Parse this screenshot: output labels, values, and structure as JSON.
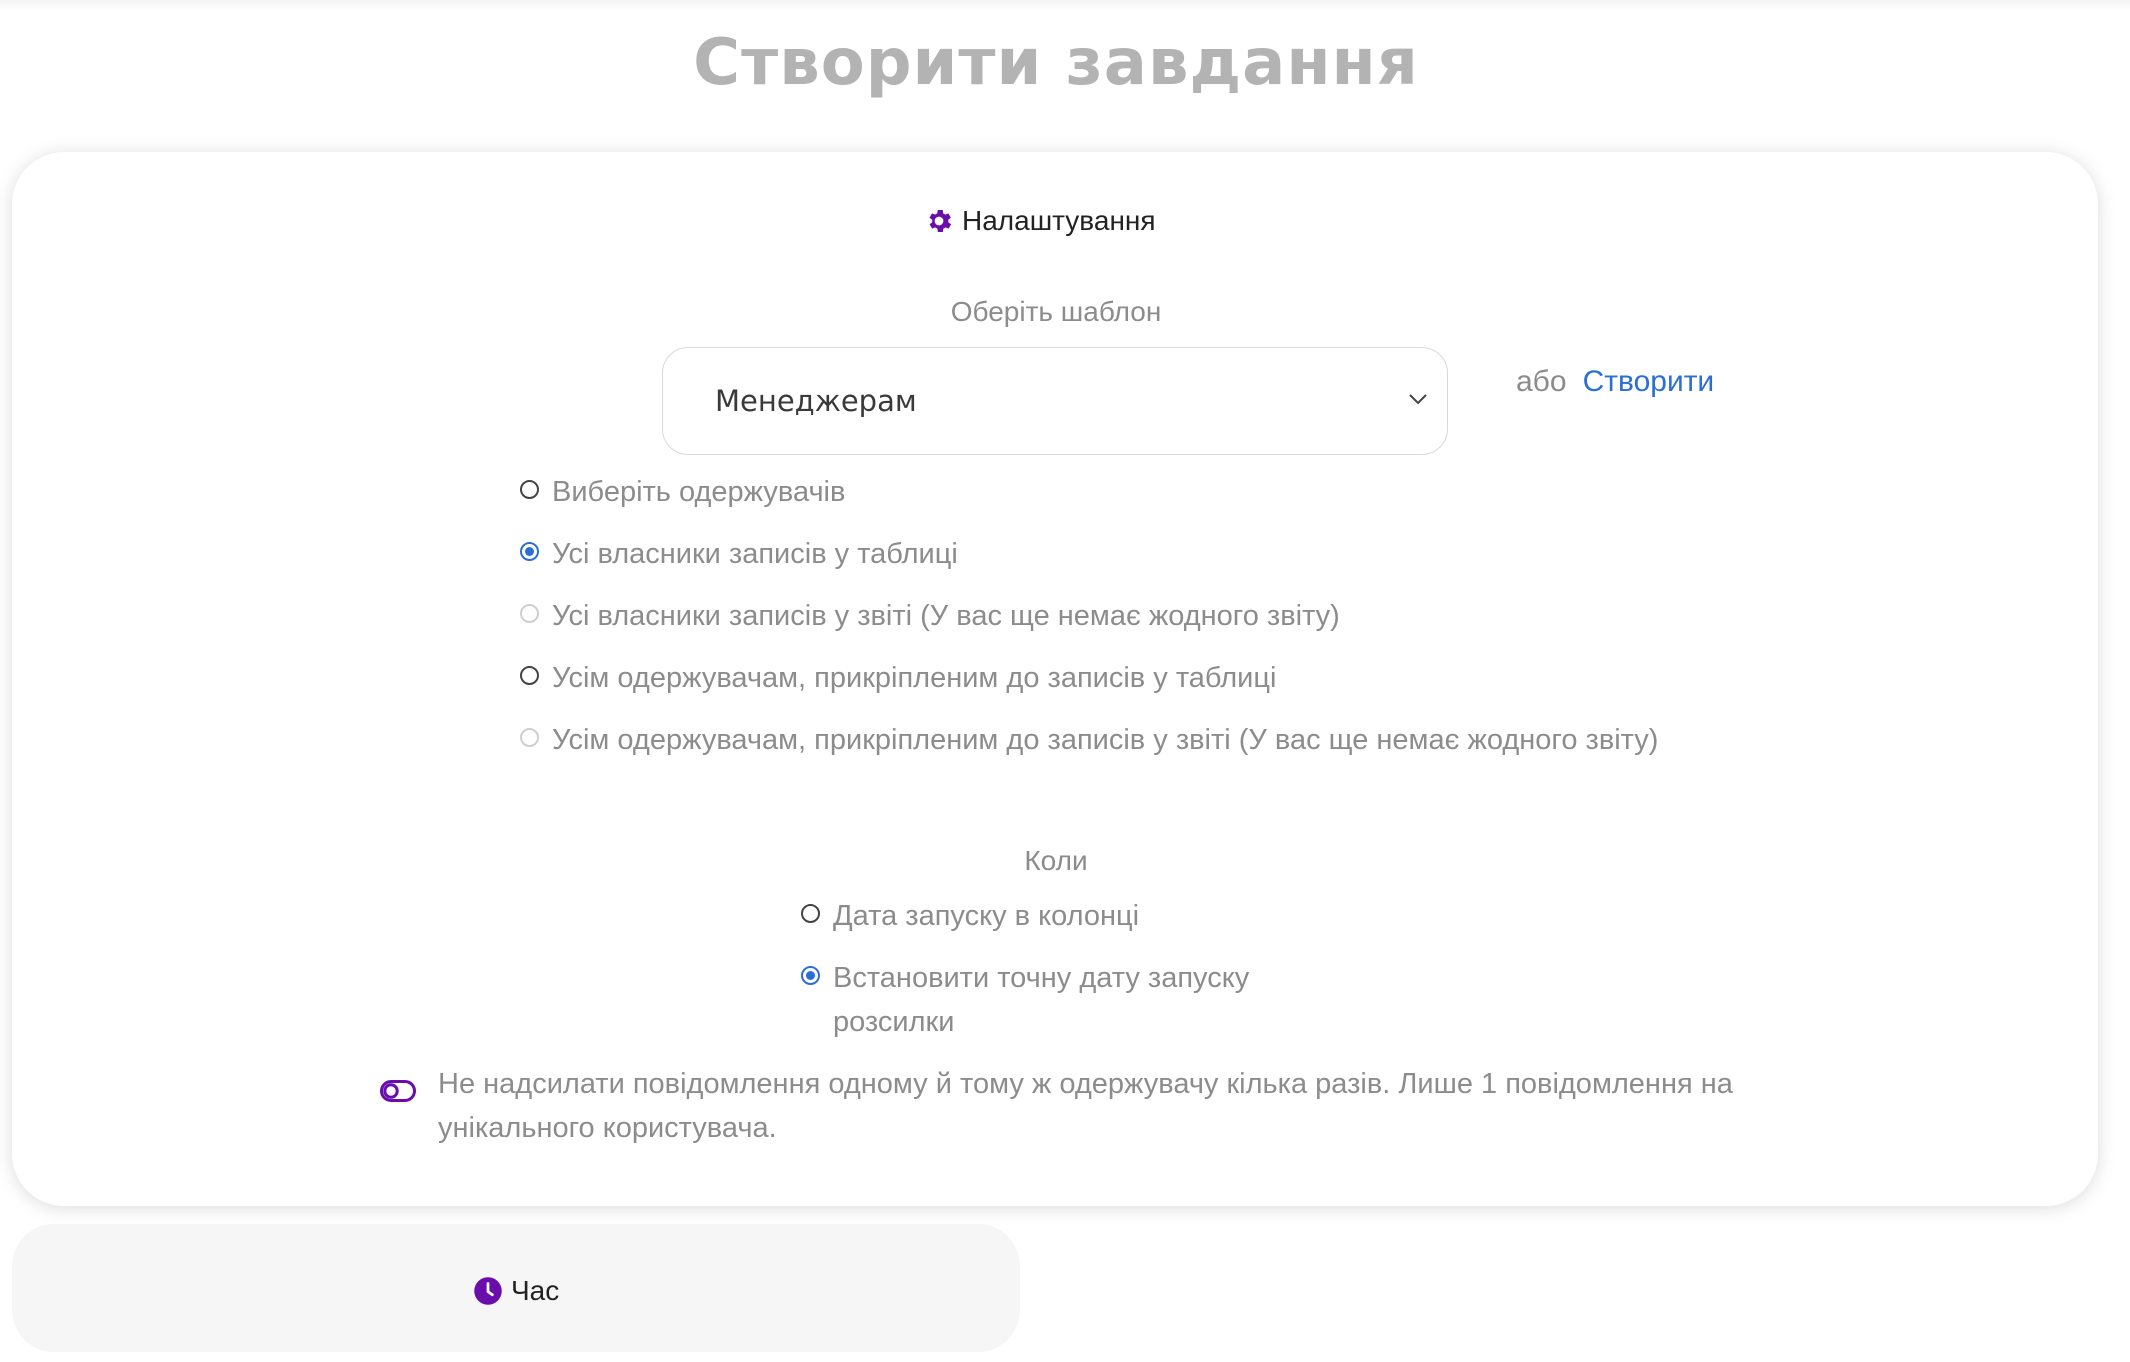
{
  "page": {
    "title": "Створити завдання"
  },
  "settings": {
    "header": "Налаштування",
    "header_icon": "gear-icon",
    "template_label": "Оберіть шаблон",
    "template_select": {
      "selected": "Менеджерам"
    },
    "or_text": "або",
    "create_link": "Створити",
    "recipients": [
      {
        "label": "Виберіть одержувачів",
        "checked": false,
        "disabled": false
      },
      {
        "label": "Усі власники записів у таблиці",
        "checked": true,
        "disabled": false
      },
      {
        "label": "Усі власники записів у звіті (У вас ще немає жодного звіту)",
        "checked": false,
        "disabled": true
      },
      {
        "label": "Усім одержувачам, прикріпленим до записів у таблиці",
        "checked": false,
        "disabled": false
      },
      {
        "label": "Усім одержувачам, прикріпленим до записів у звіті (У вас ще немає жодного звіту)",
        "checked": false,
        "disabled": true
      }
    ],
    "when_label": "Коли",
    "when_options": [
      {
        "label": "Дата запуску в колонці",
        "checked": false
      },
      {
        "label": "Встановити точну дату запуску розсилки",
        "checked": true
      }
    ],
    "dedupe_toggle": {
      "label": "Не надсилати повідомлення одному й тому ж одержувачу кілька разів. Лише 1 повідомлення на унікального користувача.",
      "enabled": false
    }
  },
  "time": {
    "header": "Час",
    "header_icon": "clock-icon"
  },
  "colors": {
    "accent_purple": "#6a0dad",
    "link_blue": "#2b6fd6",
    "muted_text": "#8c8c8c",
    "title_gray": "#b3b3b3"
  }
}
